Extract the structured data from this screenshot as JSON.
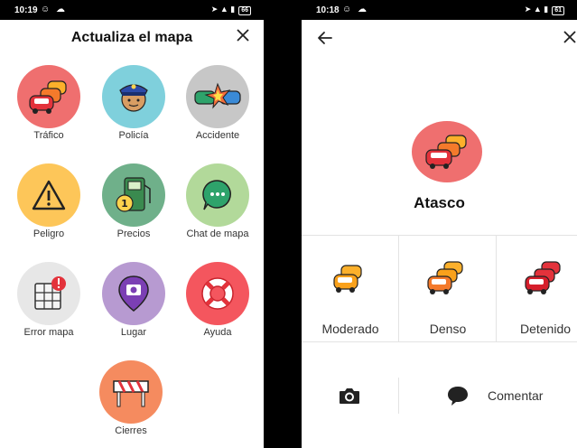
{
  "left": {
    "status": {
      "time": "10:19",
      "battery": "66"
    },
    "title": "Actualiza el mapa",
    "tiles": [
      {
        "label": "Tráfico",
        "icon": "traffic-cars-icon",
        "color": "#ef6f6f"
      },
      {
        "label": "Policía",
        "icon": "police-icon",
        "color": "#7fd0dc"
      },
      {
        "label": "Accidente",
        "icon": "accident-icon",
        "color": "#c7c7c7"
      },
      {
        "label": "Peligro",
        "icon": "warning-icon",
        "color": "#fdc659"
      },
      {
        "label": "Precios",
        "icon": "fuel-price-icon",
        "color": "#6fb08a"
      },
      {
        "label": "Chat de mapa",
        "icon": "chat-bubble-icon",
        "color": "#b2d99a"
      },
      {
        "label": "Error mapa",
        "icon": "map-error-icon",
        "color": "#e7e7e7"
      },
      {
        "label": "Lugar",
        "icon": "place-pin-icon",
        "color": "#b79ad1"
      },
      {
        "label": "Ayuda",
        "icon": "lifebuoy-icon",
        "color": "#f4565e"
      },
      {
        "label": "Cierres",
        "icon": "road-closure-icon",
        "color": "#f58b5f"
      }
    ]
  },
  "right": {
    "status": {
      "time": "10:18",
      "battery": "61"
    },
    "title": "Atasco",
    "options": [
      {
        "label": "Moderado",
        "icon": "traffic-moderate-icon"
      },
      {
        "label": "Denso",
        "icon": "traffic-dense-icon"
      },
      {
        "label": "Detenido",
        "icon": "traffic-stopped-icon"
      }
    ],
    "actions": {
      "comment_label": "Comentar"
    }
  }
}
